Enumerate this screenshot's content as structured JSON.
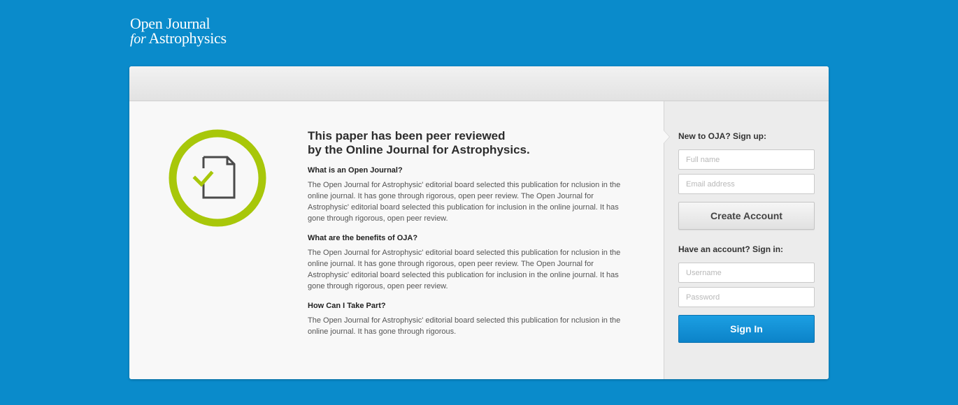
{
  "logo": {
    "line1": "Open Journal",
    "line2_for": "for",
    "line2_rest": " Astrophysics"
  },
  "badge": {
    "icon": "document-check-icon",
    "ring_color": "#a8c70a"
  },
  "main": {
    "headline_line1": "This paper has been peer reviewed",
    "headline_line2": "by the Online Journal for Astrophysics.",
    "sections": [
      {
        "title": "What is an Open Journal?",
        "body": "The Open Journal for Astrophysic' editorial board selected this publication for nclusion in the online journal. It has gone through rigorous, open peer review. The Open Journal for Astrophysic' editorial board selected this publication for inclusion in the online journal. It has gone through rigorous, open peer review."
      },
      {
        "title": "What are the benefits of OJA?",
        "body": "The Open Journal for Astrophysic' editorial board selected this publication for nclusion in the online journal. It has gone through rigorous, open peer review. The Open Journal for Astrophysic' editorial board selected this publication for inclusion in the online journal. It has gone through rigorous, open peer review."
      },
      {
        "title": "How Can I Take Part?",
        "body": "The Open Journal for Astrophysic' editorial board selected this publication for nclusion in the online journal. It has gone through rigorous."
      }
    ]
  },
  "signup": {
    "heading": "New to OJA? Sign up:",
    "fullname_placeholder": "Full name",
    "email_placeholder": "Email address",
    "button": "Create Account"
  },
  "signin": {
    "heading": "Have an account? Sign in:",
    "username_placeholder": "Username",
    "password_placeholder": "Password",
    "button": "Sign In"
  },
  "colors": {
    "background": "#0a8bcb",
    "accent_green": "#a8c70a",
    "button_blue": "#1590d6"
  }
}
